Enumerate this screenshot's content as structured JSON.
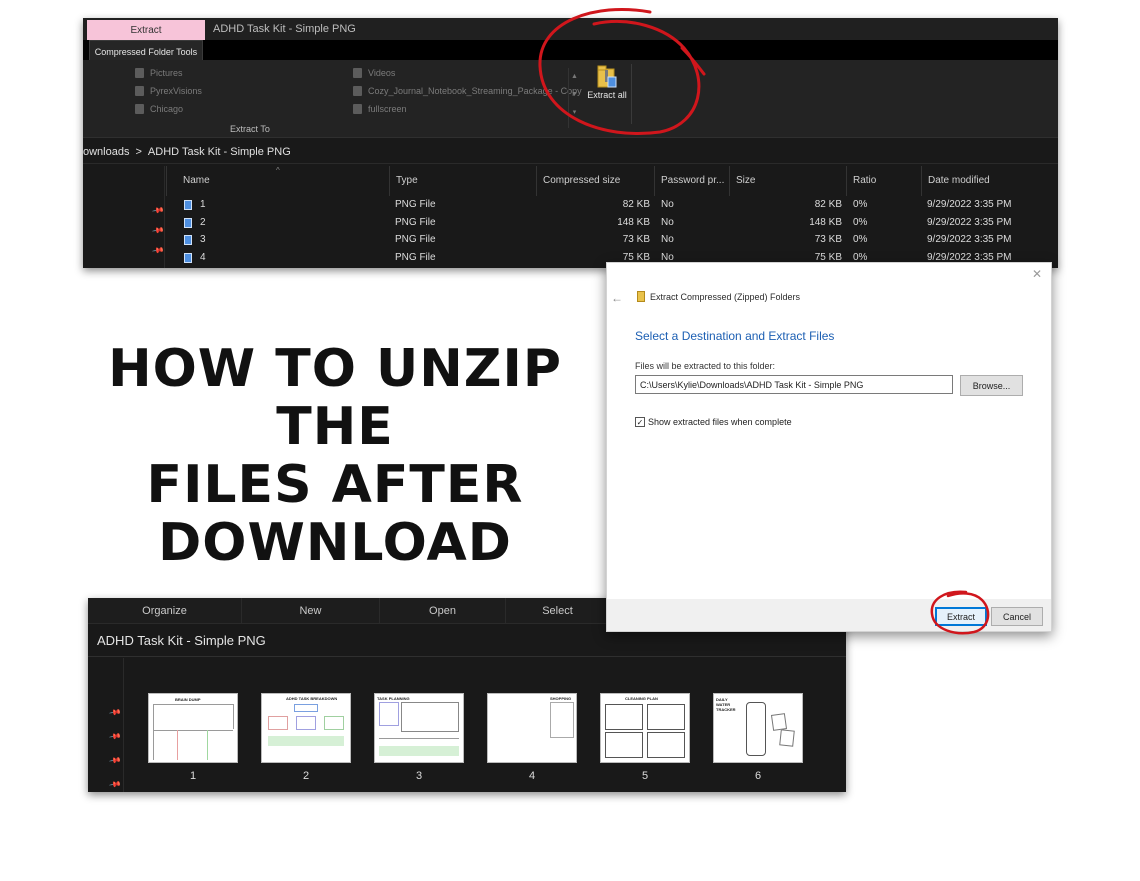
{
  "explorer_top": {
    "ribbon_tab_extract": "Extract",
    "window_title": "ADHD Task Kit - Simple PNG",
    "ribbon_tab_tools": "Compressed Folder Tools",
    "ribbon_items_left": [
      "Pictures",
      "PyrexVisions",
      "Chicago"
    ],
    "ribbon_items_right": [
      "Videos",
      "Cozy_Journal_Notebook_Streaming_Package - Copy",
      "fullscreen"
    ],
    "extract_all_label": "Extract all",
    "group_label": "Extract To",
    "breadcrumb": [
      "ownloads",
      ">",
      "ADHD Task Kit - Simple PNG"
    ],
    "columns": [
      "Name",
      "Type",
      "Compressed size",
      "Password pr...",
      "Size",
      "Ratio",
      "Date modified"
    ],
    "rows": [
      {
        "name": "1",
        "type": "PNG File",
        "compressed": "82 KB",
        "password": "No",
        "size": "82 KB",
        "ratio": "0%",
        "date": "9/29/2022 3:35 PM"
      },
      {
        "name": "2",
        "type": "PNG File",
        "compressed": "148 KB",
        "password": "No",
        "size": "148 KB",
        "ratio": "0%",
        "date": "9/29/2022 3:35 PM"
      },
      {
        "name": "3",
        "type": "PNG File",
        "compressed": "73 KB",
        "password": "No",
        "size": "73 KB",
        "ratio": "0%",
        "date": "9/29/2022 3:35 PM"
      },
      {
        "name": "4",
        "type": "PNG File",
        "compressed": "75 KB",
        "password": "No",
        "size": "75 KB",
        "ratio": "0%",
        "date": "9/29/2022 3:35 PM"
      }
    ]
  },
  "dialog": {
    "heading": "Extract Compressed (Zipped) Folders",
    "title": "Select a Destination and Extract Files",
    "label": "Files will be extracted to this folder:",
    "path_value": "C:\\Users\\Kylie\\Downloads\\ADHD Task Kit - Simple PNG",
    "browse_label": "Browse...",
    "checkbox_label": "Show extracted files when complete",
    "checkbox_checked": true,
    "extract_label": "Extract",
    "cancel_label": "Cancel",
    "close_glyph": "✕",
    "back_glyph": "←"
  },
  "headline": {
    "lines": [
      "HOW TO UNZIP THE",
      "FILES AFTER",
      "DOWNLOAD"
    ]
  },
  "explorer_bottom": {
    "commands": [
      "Organize",
      "New",
      "Open",
      "Select"
    ],
    "folder_title": "ADHD Task Kit - Simple PNG",
    "thumbnails": [
      {
        "label": "1",
        "heading": "BRAIN DUMP"
      },
      {
        "label": "2",
        "heading": "ADHD TASK BREAKDOWN"
      },
      {
        "label": "3",
        "heading": "TASK PLANNING"
      },
      {
        "label": "4",
        "heading": "SHOPPING LIST"
      },
      {
        "label": "5",
        "heading": "CLEANING PLAN"
      },
      {
        "label": "6",
        "heading": "DAILY WATER TRACKER"
      }
    ]
  },
  "colors": {
    "annotation_red": "#d0161c",
    "pink_tab": "#f7c4d9",
    "dark_bg": "#191919",
    "link_blue": "#1c5fb3",
    "primary_border": "#0078d7"
  },
  "icons": [
    "zip-folder-icon",
    "pin-icon",
    "png-file-icon",
    "back-arrow-icon",
    "close-icon",
    "checkbox-icon"
  ]
}
